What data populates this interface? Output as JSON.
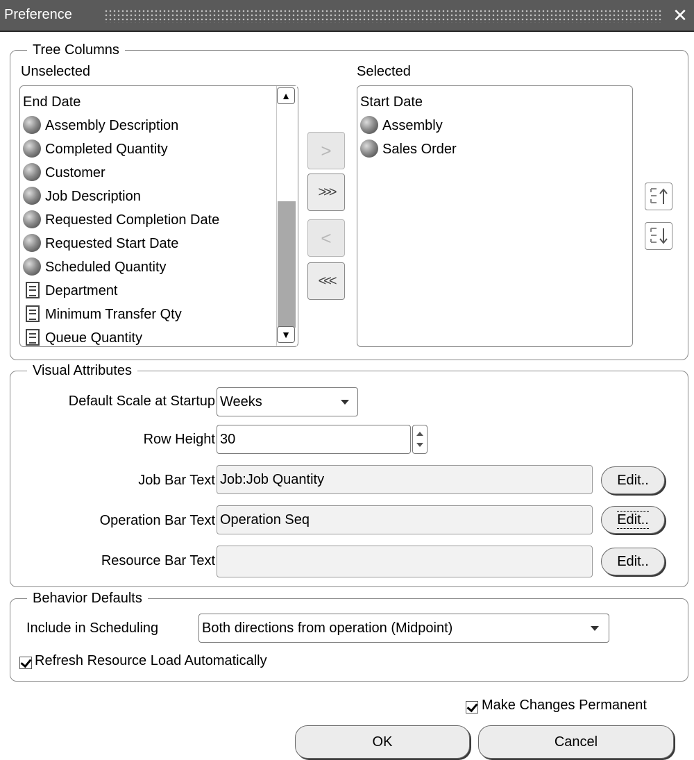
{
  "window": {
    "title": "Preference",
    "close_glyph": "✕"
  },
  "tree_columns": {
    "group_label": "Tree Columns",
    "unselected_label": "Unselected",
    "selected_label": "Selected",
    "unselected_items": [
      {
        "label": "End Date",
        "icon": "none"
      },
      {
        "label": "Assembly Description",
        "icon": "cube-icon"
      },
      {
        "label": "Completed Quantity",
        "icon": "cube-icon"
      },
      {
        "label": "Customer",
        "icon": "cube-icon"
      },
      {
        "label": "Job Description",
        "icon": "cube-icon"
      },
      {
        "label": "Requested Completion Date",
        "icon": "cube-icon"
      },
      {
        "label": "Requested Start Date",
        "icon": "cube-icon"
      },
      {
        "label": "Scheduled Quantity",
        "icon": "cube-icon"
      },
      {
        "label": "Department",
        "icon": "document-icon"
      },
      {
        "label": "Minimum Transfer Qty",
        "icon": "document-icon"
      },
      {
        "label": "Queue Quantity",
        "icon": "document-icon"
      }
    ],
    "selected_items": [
      {
        "label": "Start Date",
        "icon": "none"
      },
      {
        "label": "Assembly",
        "icon": "cube-icon"
      },
      {
        "label": "Sales Order",
        "icon": "cube-icon"
      }
    ],
    "shuttle": {
      "move": ">",
      "move_all": ">>>",
      "remove": "<",
      "remove_all": "<<<"
    }
  },
  "visual_attributes": {
    "group_label": "Visual Attributes",
    "default_scale_label": "Default Scale at Startup",
    "default_scale_value": "Weeks",
    "row_height_label": "Row Height",
    "row_height_value": "30",
    "job_bar_label": "Job Bar Text",
    "job_bar_value": "Job:Job Quantity",
    "operation_bar_label": "Operation Bar Text",
    "operation_bar_value": "Operation Seq",
    "resource_bar_label": "Resource Bar Text",
    "resource_bar_value": "",
    "edit_label": "Edit.."
  },
  "behavior_defaults": {
    "group_label": "Behavior Defaults",
    "include_label": "Include in Scheduling",
    "include_value": "Both directions from operation (Midpoint)",
    "refresh_label": "Refresh Resource Load Automatically",
    "refresh_checked": true
  },
  "footer": {
    "permanent_label": "Make Changes Permanent",
    "permanent_checked": true,
    "ok_label": "OK",
    "cancel_label": "Cancel"
  }
}
